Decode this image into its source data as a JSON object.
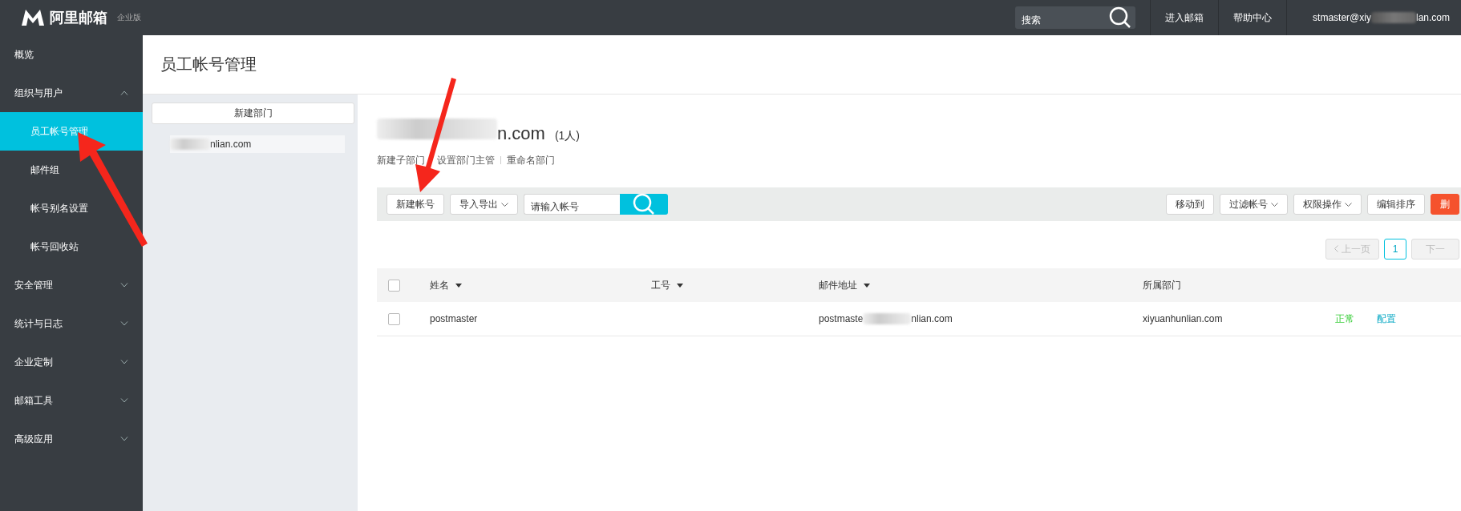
{
  "app": {
    "logo_text": "阿里邮箱",
    "edition": "企业版"
  },
  "top_bar": {
    "search": {
      "placeholder": "搜索"
    },
    "links": [
      "进入邮箱",
      "帮助中心"
    ],
    "account": {
      "visible_start": "stmaster@xiy",
      "visible_end": "lan.com"
    }
  },
  "sidebar": {
    "items": [
      {
        "label": "概览",
        "kind": "link"
      },
      {
        "label": "组织与用户",
        "kind": "group",
        "expanded": true,
        "children": [
          {
            "label": "员工帐号管理",
            "selected": true
          },
          {
            "label": "邮件组",
            "selected": false
          },
          {
            "label": "帐号别名设置",
            "selected": false
          },
          {
            "label": "帐号回收站",
            "selected": false
          }
        ]
      },
      {
        "label": "安全管理",
        "kind": "group",
        "expanded": false
      },
      {
        "label": "统计与日志",
        "kind": "group",
        "expanded": false
      },
      {
        "label": "企业定制",
        "kind": "group",
        "expanded": false
      },
      {
        "label": "邮箱工具",
        "kind": "group",
        "expanded": false
      },
      {
        "label": "高级应用",
        "kind": "group",
        "expanded": false
      }
    ]
  },
  "page": {
    "title": "员工帐号管理"
  },
  "departments": {
    "new_button": "新建部门",
    "items": [
      {
        "visible_end": "nlian.com",
        "selected": true
      }
    ]
  },
  "department": {
    "name_visible_end": "n.com",
    "count": "(1人)",
    "actions": [
      "新建子部门",
      "设置部门主管",
      "重命名部门"
    ]
  },
  "toolbar": {
    "left": [
      {
        "label": "新建帐号",
        "kind": "button"
      },
      {
        "label": "导入导出",
        "kind": "dropdown"
      }
    ],
    "search": {
      "placeholder": "请输入帐号"
    },
    "right": [
      {
        "label": "移动到",
        "kind": "button"
      },
      {
        "label": "过滤帐号",
        "kind": "dropdown"
      },
      {
        "label": "权限操作",
        "kind": "dropdown"
      },
      {
        "label": "编辑排序",
        "kind": "button"
      },
      {
        "label": "删",
        "kind": "danger"
      }
    ]
  },
  "pagination": {
    "prev": {
      "label": "上一页",
      "disabled": true
    },
    "pages": [
      {
        "label": "1",
        "selected": true
      }
    ],
    "next": {
      "label": "下一",
      "disabled": true
    }
  },
  "table": {
    "select_all": {
      "checked": false
    },
    "columns": [
      {
        "label": "姓名",
        "sortable": true
      },
      {
        "label": "工号",
        "sortable": true
      },
      {
        "label": "邮件地址",
        "sortable": true
      },
      {
        "label": "所属部门",
        "sortable": false
      }
    ],
    "rows": [
      {
        "checked": false,
        "name": "postmaster",
        "email_start": "postmaste",
        "email_end": "nlian.com",
        "department": "xiyuanhunlian.com",
        "status": "正常",
        "action": "配置"
      }
    ]
  },
  "annotations": [
    {
      "kind": "arrow"
    },
    {
      "kind": "arrow"
    }
  ]
}
